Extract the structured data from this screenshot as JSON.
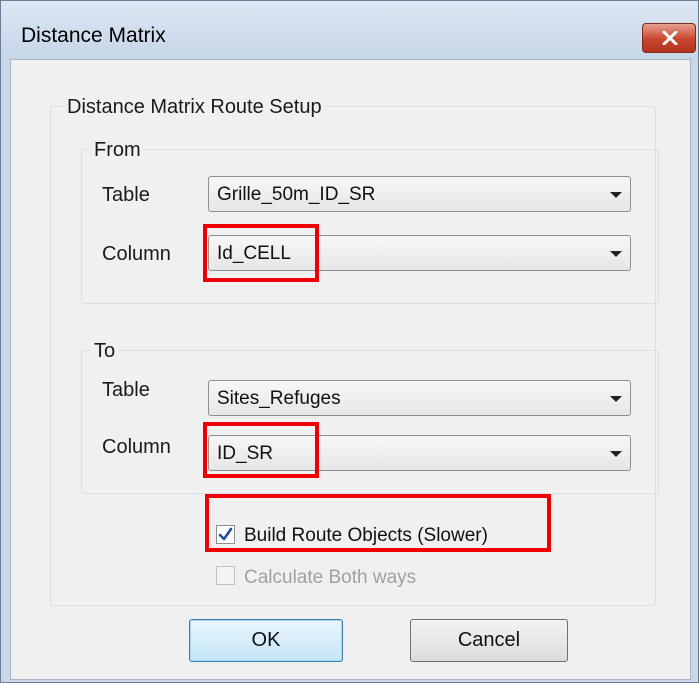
{
  "window": {
    "title": "Distance Matrix"
  },
  "setup": {
    "title": "Distance Matrix Route Setup"
  },
  "from": {
    "title": "From",
    "table_label": "Table",
    "table_value": "Grille_50m_ID_SR",
    "column_label": "Column",
    "column_value": "Id_CELL"
  },
  "to": {
    "title": "To",
    "table_label": "Table",
    "table_value": "Sites_Refuges",
    "column_label": "Column",
    "column_value": "ID_SR"
  },
  "options": {
    "build_route_label": "Build Route Objects (Slower)",
    "build_route_checked": true,
    "calculate_both_label": "Calculate Both ways",
    "calculate_both_checked": false,
    "calculate_both_enabled": false
  },
  "buttons": {
    "ok": "OK",
    "cancel": "Cancel"
  },
  "colors": {
    "highlight": "#ee0000",
    "close_button": "#c8452e",
    "check_mark": "#1f4f9a"
  },
  "icons": {
    "close": "close-icon",
    "check": "check-icon",
    "dropdown": "chevron-down-icon"
  }
}
